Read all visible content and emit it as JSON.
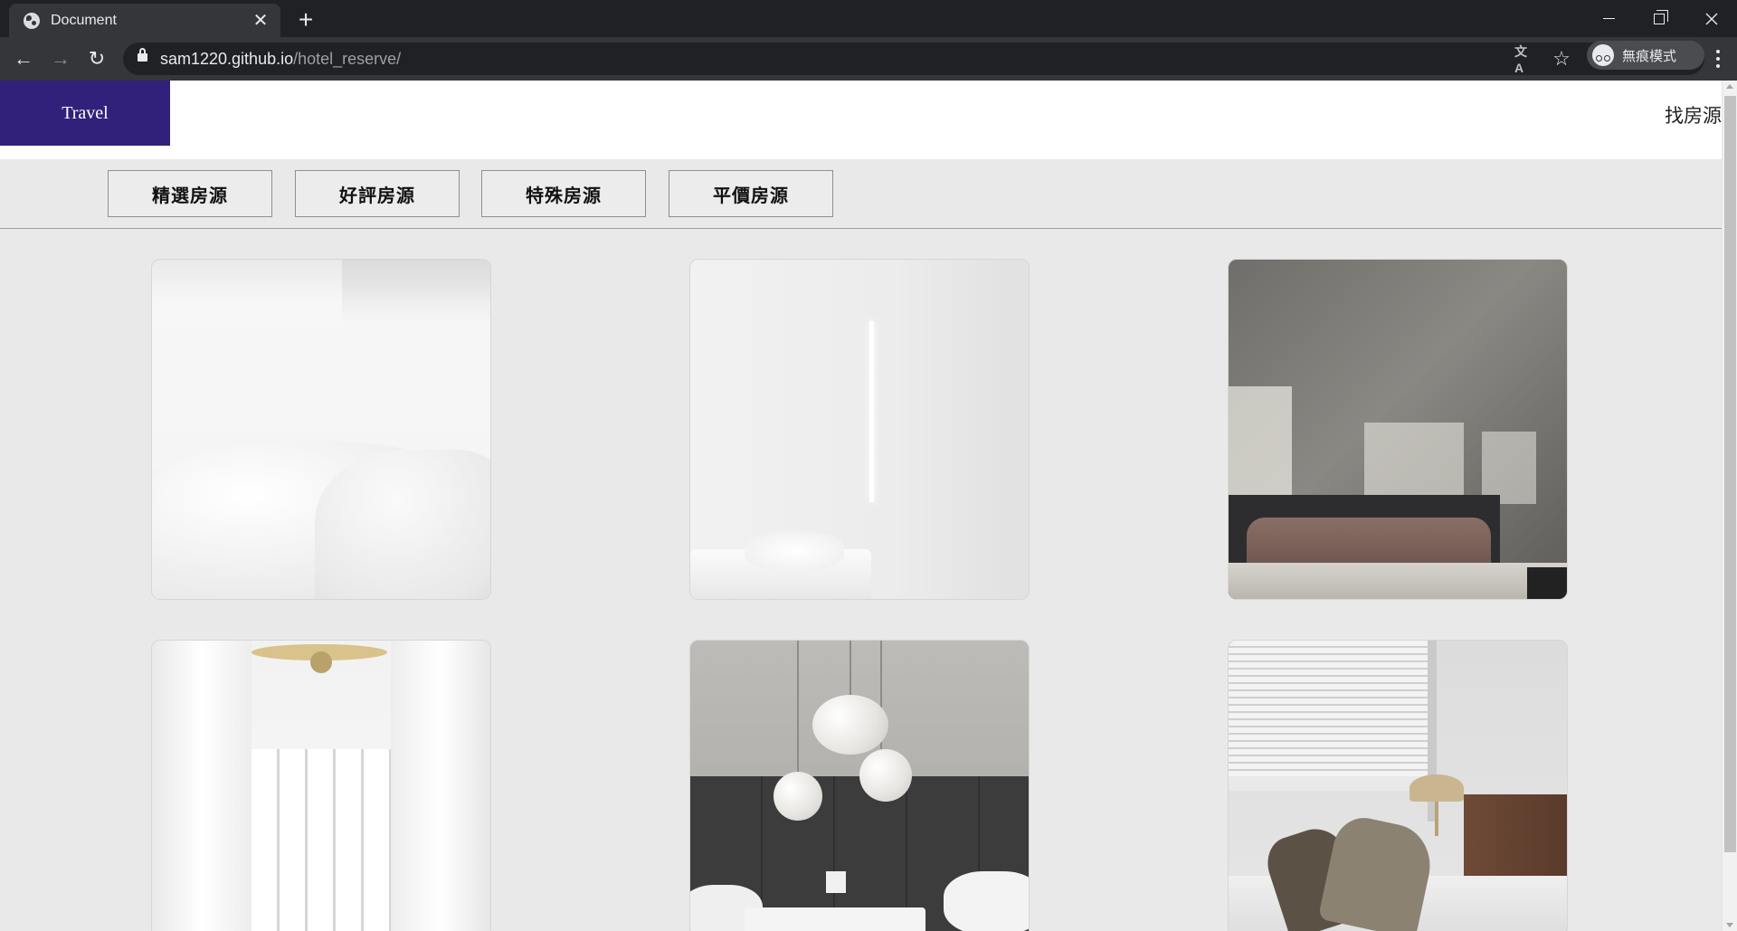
{
  "browser": {
    "tab_title": "Document",
    "tab_close_icon": "✕",
    "new_tab_icon": "+",
    "url_host": "sam1220.github.io",
    "url_path": "/hotel_reserve/",
    "profile_label": "無痕模式",
    "translate_icon": "文A",
    "star_icon": "☆",
    "back_icon": "←",
    "forward_icon": "→",
    "reload_icon": "↻"
  },
  "site": {
    "brand": "Travel",
    "find_link": "找房源"
  },
  "filters": [
    {
      "label": "精選房源"
    },
    {
      "label": "好評房源"
    },
    {
      "label": "特殊房源"
    },
    {
      "label": "平價房源"
    }
  ]
}
